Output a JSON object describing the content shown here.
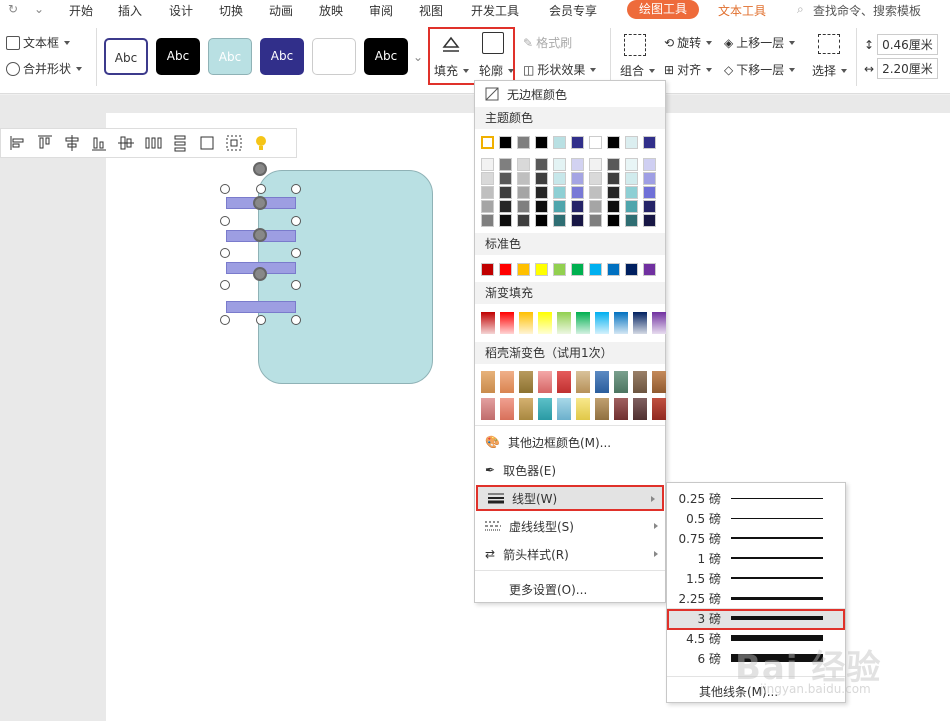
{
  "menubar": {
    "tabs": [
      "开始",
      "插入",
      "设计",
      "切换",
      "动画",
      "放映",
      "审阅",
      "视图",
      "开发工具",
      "会员专享"
    ],
    "drawing_tools": "绘图工具",
    "text_tools": "文本工具",
    "search_placeholder": "查找命令、搜索模板"
  },
  "ribbon": {
    "textbox": "文本框",
    "merge_shape": "合并形状",
    "style_boxes": [
      "Abc",
      "Abc",
      "Abc",
      "Abc",
      "",
      "Abc"
    ],
    "fill": "填充",
    "outline": "轮廓",
    "format_painter": "格式刷",
    "shape_effect": "形状效果",
    "group": "组合",
    "rotate": "旋转",
    "align": "对齐",
    "move_up": "上移一层",
    "move_down": "下移一层",
    "select": "选择",
    "height_value": "0.46厘米",
    "width_value": "2.20厘米"
  },
  "dropdown": {
    "no_border": "无边框颜色",
    "theme_colors": "主题颜色",
    "standard_colors": "标准色",
    "gradient_fill": "渐变填充",
    "docer_gradient": "稻壳渐变色（试用1次）",
    "more_border_colors": "其他边框颜色(M)...",
    "eyedropper": "取色器(E)",
    "line_type": "线型(W)",
    "dash_type": "虚线线型(S)",
    "arrow_style": "箭头样式(R)",
    "more_settings": "更多设置(O)..."
  },
  "submenu": {
    "widths": [
      "0.25 磅",
      "0.5 磅",
      "0.75 磅",
      "1 磅",
      "1.5 磅",
      "2.25 磅",
      "3 磅",
      "4.5 磅",
      "6 磅"
    ],
    "more_lines": "其他线条(M)..."
  },
  "watermark": {
    "brand": "Bai 经验",
    "url": "jingyan.baidu.com"
  },
  "colors": {
    "accent_orange": "#ee6b3b",
    "highlight_red": "#e0312a",
    "shape_fill": "#b9e0e3",
    "bar_fill": "#9d9ee2"
  }
}
